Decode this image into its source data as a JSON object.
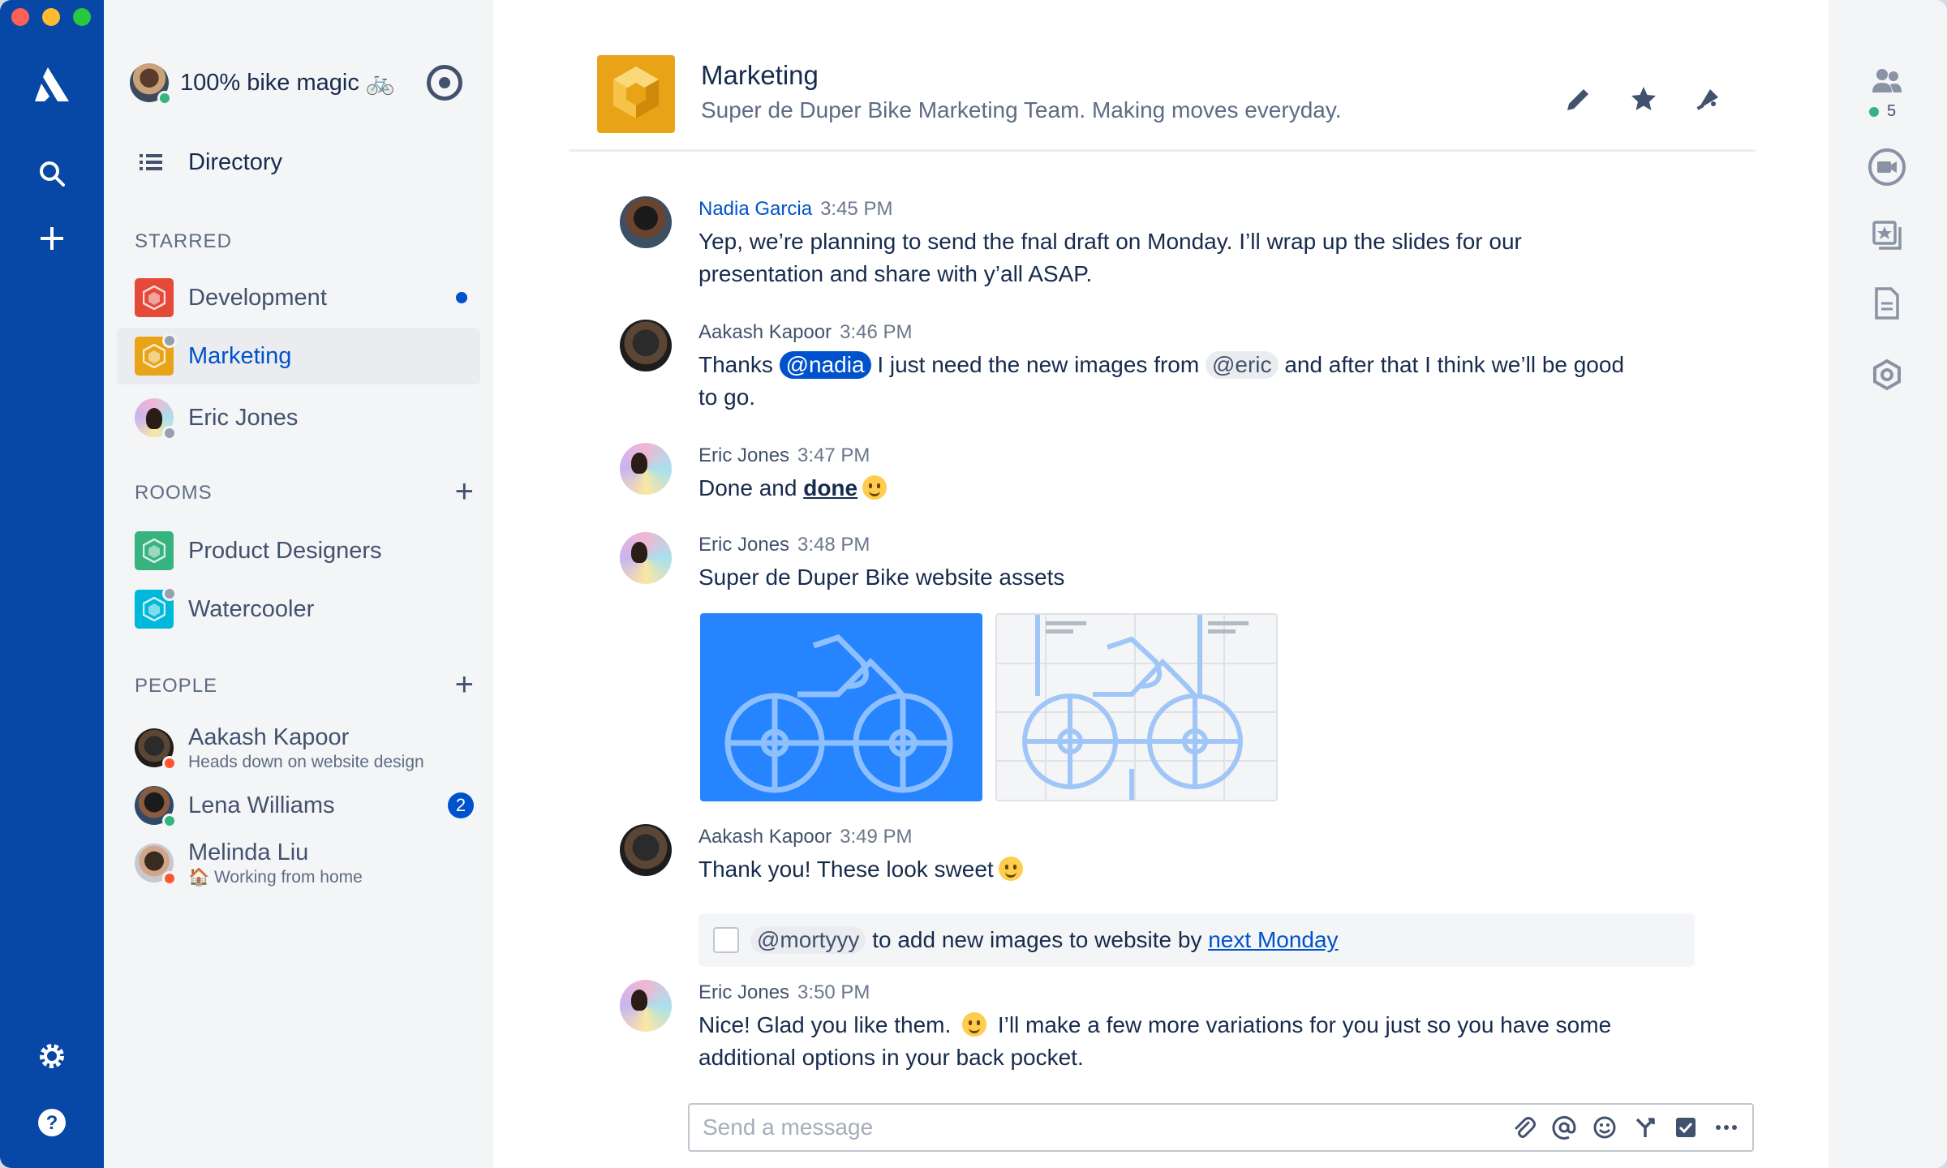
{
  "workspace": {
    "name": "100% bike magic 🚲"
  },
  "directory": {
    "label": "Directory"
  },
  "starred": {
    "title": "STARRED",
    "items": [
      {
        "label": "Development",
        "color": "#e5493a",
        "unread": true
      },
      {
        "label": "Marketing",
        "color": "#e8a317",
        "active": true
      },
      {
        "label": "Eric Jones"
      }
    ]
  },
  "rooms": {
    "title": "ROOMS",
    "items": [
      {
        "label": "Product Designers",
        "color": "#36b37e"
      },
      {
        "label": "Watercooler",
        "color": "#00b8d9"
      }
    ]
  },
  "people": {
    "title": "PEOPLE",
    "items": [
      {
        "name": "Aakash Kapoor",
        "status": "Heads down on website design"
      },
      {
        "name": "Lena Williams",
        "badge": "2"
      },
      {
        "name": "Melinda Liu",
        "status": "🏠 Working from home"
      }
    ]
  },
  "channel": {
    "title": "Marketing",
    "description": "Super de Duper Bike Marketing Team. Making moves everyday."
  },
  "messages": [
    {
      "author": "Nadia Garcia",
      "time": "3:45 PM",
      "text_line1": "Yep, we’re planning to send the fnal draft on Monday. I’ll wrap up the slides for our",
      "text_line2": "presentation and share with y’all ASAP."
    },
    {
      "author": "Aakash Kapoor",
      "time": "3:46 PM",
      "text_a": "Thanks",
      "mention_me": "@nadia",
      "text_b": "I just need the new images from",
      "mention_other": "@eric",
      "text_c": "and after that I think we’ll be good",
      "text_line2": "to go."
    },
    {
      "author": "Eric Jones",
      "time": "3:47 PM",
      "text_a": "Done and",
      "bold": "done"
    },
    {
      "author": "Eric Jones",
      "time": "3:48 PM",
      "text": "Super de Duper Bike website assets"
    },
    {
      "author": "Aakash Kapoor",
      "time": "3:49 PM",
      "text": "Thank you! These look sweet",
      "task": {
        "mention": "@mortyyy",
        "text": "to add new images to website by",
        "date": "next Monday"
      }
    },
    {
      "author": "Eric Jones",
      "time": "3:50 PM",
      "text_a": "Nice! Glad you like them.",
      "text_b": "I’ll make a few more variations for you just so you have some",
      "text_line2": "additional options in your back pocket."
    }
  ],
  "composer": {
    "placeholder": "Send a message"
  },
  "rail": {
    "participant_count": "5"
  }
}
